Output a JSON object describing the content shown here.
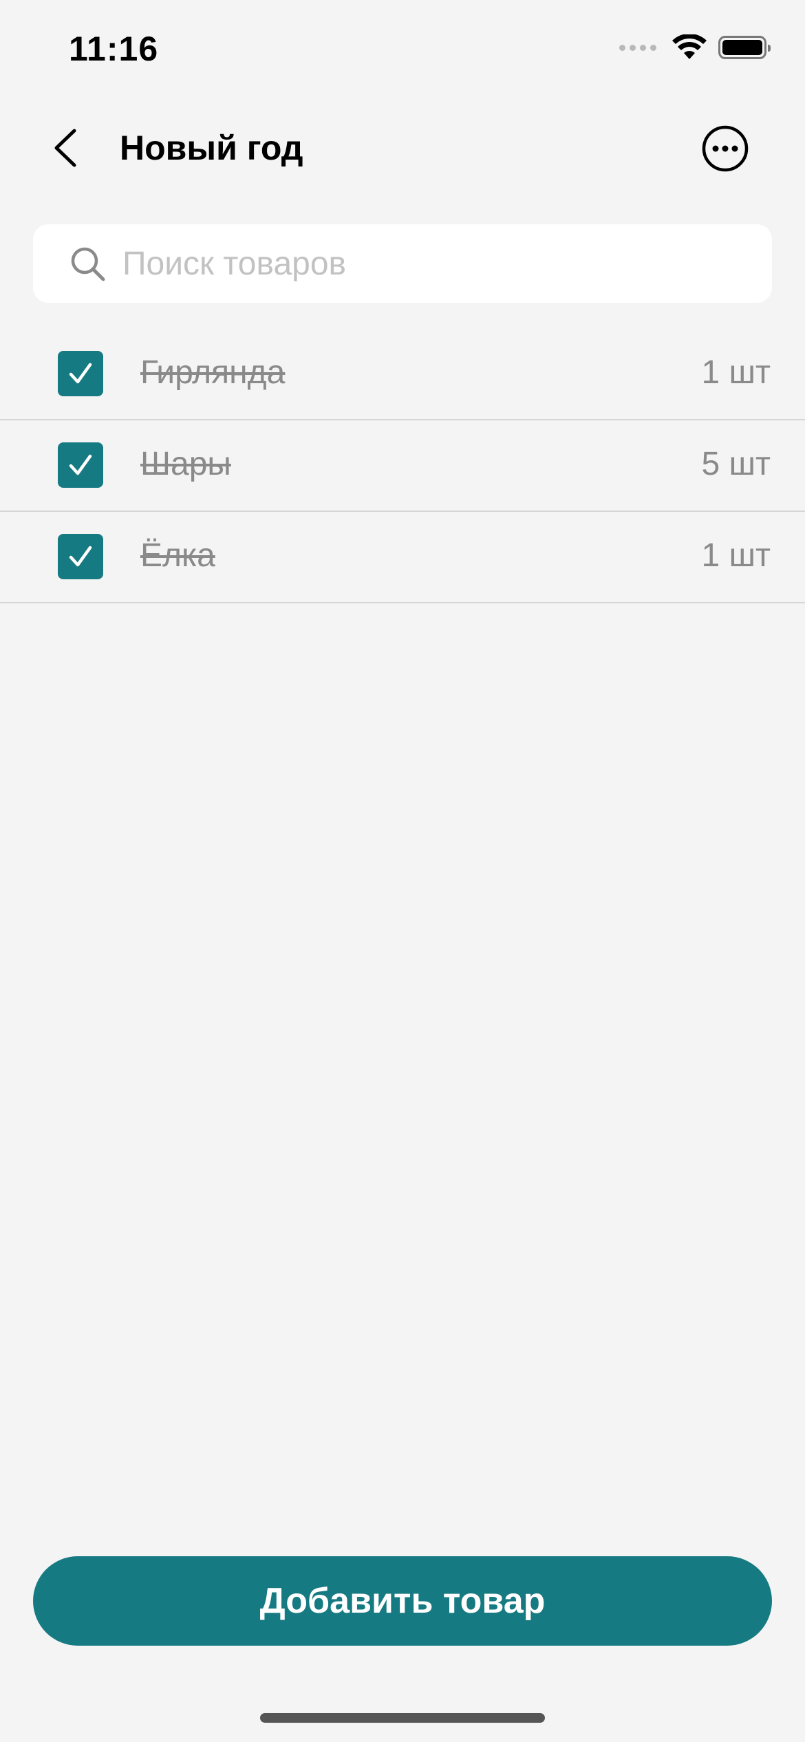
{
  "status_bar": {
    "time": "11:16"
  },
  "nav": {
    "title": "Новый год",
    "back_icon": "chevron-left-icon",
    "more_icon": "more-circle-icon"
  },
  "search": {
    "placeholder": "Поиск товаров",
    "value": ""
  },
  "items": [
    {
      "name": "Гирлянда",
      "quantity": "1 шт",
      "checked": true
    },
    {
      "name": "Шары",
      "quantity": "5 шт",
      "checked": true
    },
    {
      "name": "Ёлка",
      "quantity": "1 шт",
      "checked": true
    }
  ],
  "add_button": {
    "label": "Добавить товар"
  },
  "colors": {
    "accent": "#167a82",
    "background": "#f4f4f4",
    "muted_text": "#8a8a8a",
    "placeholder": "#c2c2c2"
  }
}
